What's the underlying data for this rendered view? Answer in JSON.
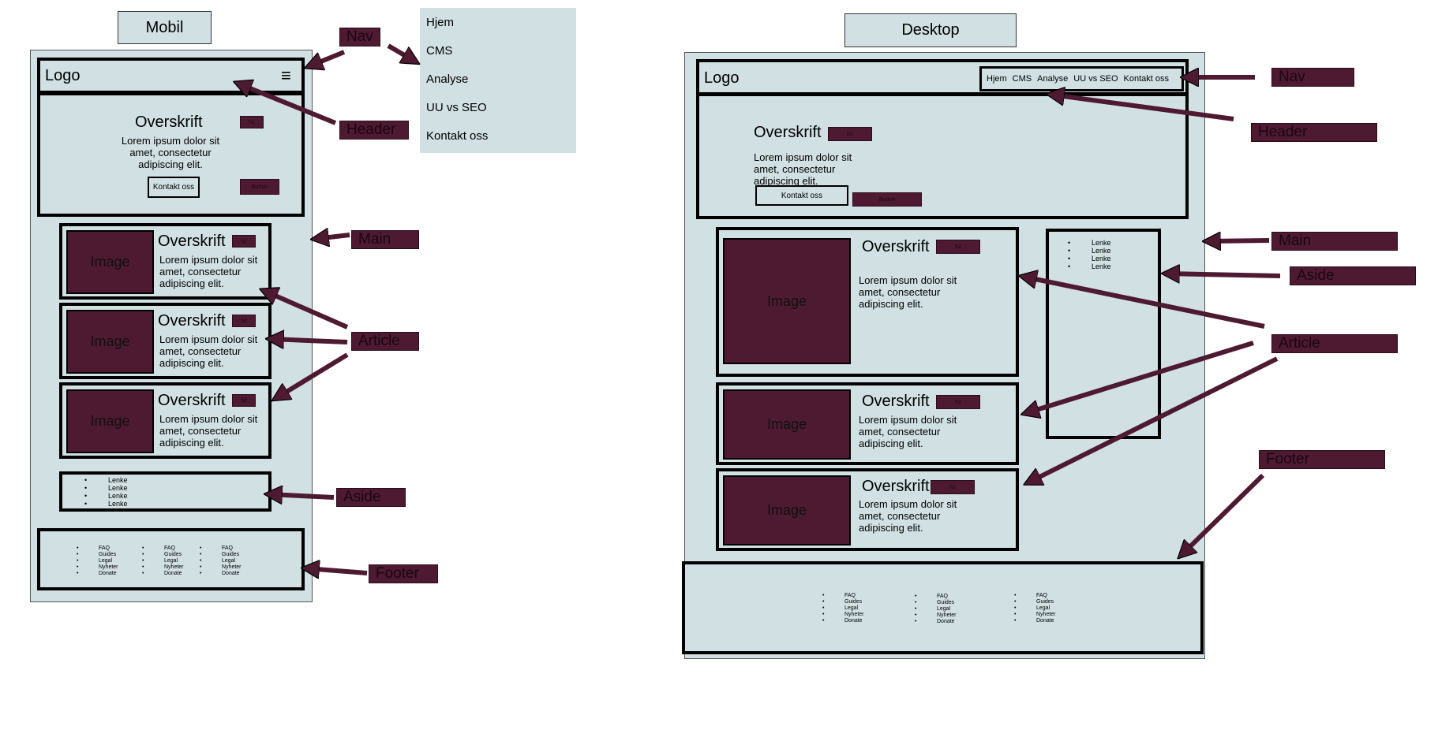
{
  "mobile": {
    "title": "Mobil",
    "logo": "Logo",
    "menu_icon": "≡",
    "header": {
      "heading": "Overskrift",
      "heading_tag": "h1",
      "text": "Lorem ipsum dolor sit amet, consectetur adipiscing elit.",
      "button": "Kontakt oss",
      "button_tag": "Button"
    },
    "articles": [
      {
        "image": "Image",
        "heading": "Overskrift",
        "tag": "h2",
        "text": "Lorem ipsum dolor sit amet, consectetur adipiscing elit."
      },
      {
        "image": "Image",
        "heading": "Overskrift",
        "tag": "h2",
        "text": "Lorem ipsum dolor sit amet, consectetur adipiscing elit."
      },
      {
        "image": "Image",
        "heading": "Overskrift",
        "tag": "h2",
        "text": "Lorem ipsum dolor sit amet, consectetur adipiscing elit."
      }
    ],
    "aside_links": [
      "Lenke",
      "Lenke",
      "Lenke",
      "Lenke"
    ],
    "footer_columns": [
      [
        "FAQ",
        "Guides",
        "Legal",
        "Nyheter",
        "Donate"
      ],
      [
        "FAQ",
        "Guides",
        "Legal",
        "Nyheter",
        "Donate"
      ],
      [
        "FAQ",
        "Guides",
        "Legal",
        "Nyheter",
        "Donate"
      ]
    ],
    "nav_menu": [
      "Hjem",
      "CMS",
      "Analyse",
      "UU vs SEO",
      "Kontakt oss"
    ],
    "labels": {
      "nav": "Nav",
      "header": "Header",
      "main": "Main",
      "article": "Article",
      "aside": "Aside",
      "footer": "Footer"
    }
  },
  "desktop": {
    "title": "Desktop",
    "logo": "Logo",
    "nav_items": [
      "Hjem",
      "CMS",
      "Analyse",
      "UU vs SEO",
      "Kontakt oss"
    ],
    "header": {
      "heading": "Overskrift",
      "heading_tag": "h1",
      "text": "Lorem ipsum dolor sit amet, consectetur adipiscing elit.",
      "button": "Kontakt oss",
      "button_tag": "Button"
    },
    "articles": [
      {
        "image": "Image",
        "heading": "Overskrift",
        "tag": "h2",
        "text": "Lorem ipsum dolor sit amet, consectetur adipiscing elit."
      },
      {
        "image": "Image",
        "heading": "Overskrift",
        "tag": "h2",
        "text": "Lorem ipsum dolor sit amet, consectetur adipiscing elit."
      },
      {
        "image": "Image",
        "heading": "Overskrift",
        "tag": "h2",
        "text": "Lorem ipsum dolor sit amet, consectetur adipiscing elit."
      }
    ],
    "aside_links": [
      "Lenke",
      "Lenke",
      "Lenke",
      "Lenke"
    ],
    "footer_columns": [
      [
        "FAQ",
        "Guides",
        "Legal",
        "Nyheter",
        "Donate"
      ],
      [
        "FAQ",
        "Guides",
        "Legal",
        "Nyheter",
        "Donate"
      ],
      [
        "FAQ",
        "Guides",
        "Legal",
        "Nyheter",
        "Donate"
      ]
    ],
    "labels": {
      "nav": "Nav",
      "header": "Header",
      "main": "Main",
      "aside": "Aside",
      "article": "Article",
      "footer": "Footer"
    }
  },
  "colors": {
    "panel": "#d1e0e2",
    "accent": "#4e1a31",
    "border": "#000000"
  }
}
